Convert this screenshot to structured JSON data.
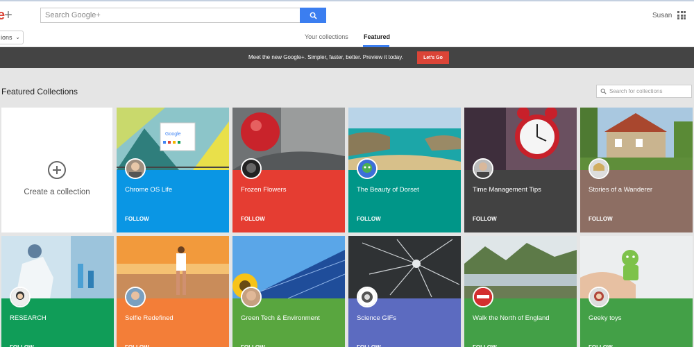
{
  "header": {
    "logo_text": "e",
    "logo_plus": "+",
    "search_placeholder": "Search Google+",
    "user_name": "Susan"
  },
  "subnav": {
    "dropdown_label": "ions",
    "tabs": [
      {
        "label": "Your collections",
        "active": false
      },
      {
        "label": "Featured",
        "active": true
      }
    ]
  },
  "banner": {
    "text": "Meet the new Google+.  Simpler, faster, better. Preview it today.",
    "button_label": "Let's Go"
  },
  "section": {
    "title": "Featured Collections",
    "search_placeholder": "Search for collections"
  },
  "create_card": {
    "label": "Create a collection"
  },
  "follow_label": "FOLLOW",
  "cards": [
    {
      "title": "Chrome OS Life",
      "color": "#0a96e4",
      "image_name": "google-chrome-window-image",
      "avatar_name": "man-avatar"
    },
    {
      "title": "Frozen Flowers",
      "color": "#e53d32",
      "image_name": "frozen-red-flower-image",
      "avatar_name": "dark-avatar"
    },
    {
      "title": "The Beauty of Dorset",
      "color": "#009688",
      "image_name": "coastal-bay-image",
      "avatar_name": "character-avatar"
    },
    {
      "title": "Time Management Tips",
      "color": "#424242",
      "image_name": "red-alarm-clock-image",
      "avatar_name": "man-avatar"
    },
    {
      "title": "Stories of a Wanderer",
      "color": "#8d6e63",
      "image_name": "stone-cottage-image",
      "avatar_name": "woman-avatar"
    },
    {
      "title": "RESEARCH",
      "color": "#109d58",
      "image_name": "laboratory-scientist-image",
      "avatar_name": "woman-avatar"
    },
    {
      "title": "Selfie Redefined",
      "color": "#f37e38",
      "image_name": "beach-sunset-woman-image",
      "avatar_name": "woman-avatar"
    },
    {
      "title": "Green Tech & Environment",
      "color": "#59a63f",
      "image_name": "solar-panels-sunflower-image",
      "avatar_name": "man-avatar"
    },
    {
      "title": "Science GIFs",
      "color": "#5c6bc0",
      "image_name": "glass-shatter-image",
      "avatar_name": "bw-avatar"
    },
    {
      "title": "Walk the North of England",
      "color": "#43a047",
      "image_name": "lake-mountains-image",
      "avatar_name": "countrys-logo-avatar"
    },
    {
      "title": "Geeky toys",
      "color": "#43a047",
      "image_name": "android-figure-image",
      "avatar_name": "woman-avatar"
    }
  ],
  "colors": {
    "accent_blue": "#3b7ef0",
    "brand_red": "#db4437",
    "banner_bg": "#444444"
  }
}
